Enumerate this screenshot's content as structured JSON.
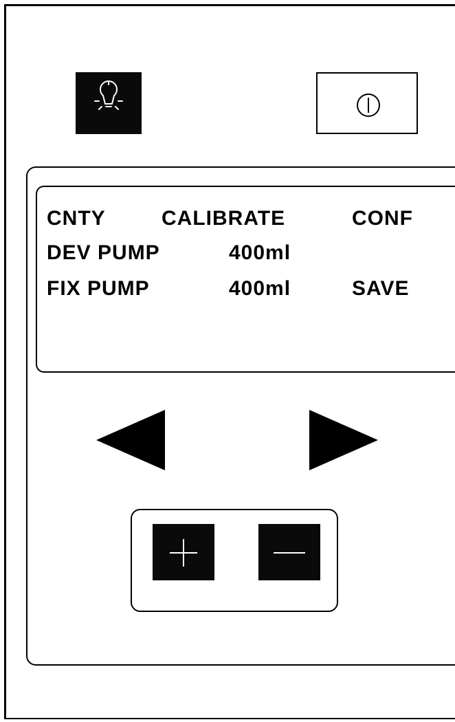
{
  "display": {
    "row1": {
      "left": "CNTY",
      "middle": "CALIBRATE",
      "right": "CONF"
    },
    "row2": {
      "left": "DEV PUMP",
      "middle": "400ml"
    },
    "row3": {
      "left": "FIX PUMP",
      "middle": "400ml",
      "right": "SAVE"
    }
  },
  "icons": {
    "light": "light-bulb-icon",
    "power": "power-icon",
    "left": "left-arrow-icon",
    "right": "right-arrow-icon",
    "plus": "plus-icon",
    "minus": "minus-icon"
  }
}
